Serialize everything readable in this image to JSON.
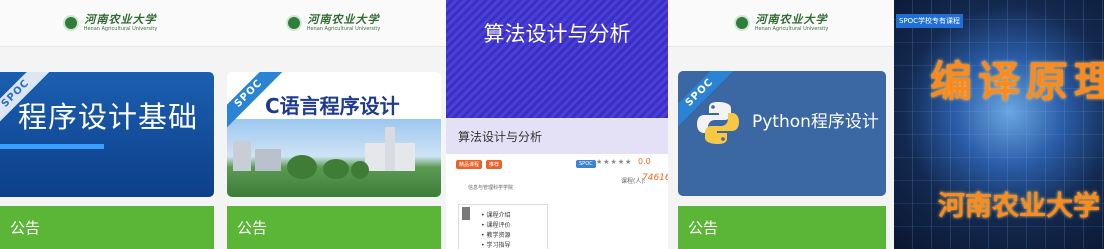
{
  "panels": [
    {
      "logo_cn": "河南农业大学",
      "logo_en": "Henan Agricultural University",
      "badge": "SPOC",
      "course_title": "程序设计基础",
      "notice": "公告"
    },
    {
      "logo_cn": "河南农业大学",
      "logo_en": "Henan Agricultural University",
      "badge": "SPOC",
      "course_title": "C语言程序设计",
      "notice": "公告"
    },
    {
      "banner_title": "算法设计与分析",
      "course_title": "算法设计与分析",
      "tags": [
        "精品课程",
        "推荐"
      ],
      "spoc_tag": "SPOC",
      "rating": "0.0",
      "learners_label": "课程(人):",
      "learners": "74616",
      "school": "信息与管理科学学院",
      "menu": [
        "课程介绍",
        "课程评价",
        "教学资源",
        "学习指导"
      ]
    },
    {
      "logo_cn": "河南农业大学",
      "logo_en": "Henan Agricultural University",
      "badge": "SPOC",
      "course_title": "Python程序设计",
      "notice": "公告"
    },
    {
      "tag": "SPOC学校专有课程",
      "course_title": "编译原理",
      "school": "河南农业大学"
    }
  ],
  "colors": {
    "notice_green": "#5bb536",
    "logo_green": "#2f7d3b",
    "accent_orange": "#ff8a1c"
  },
  "icons": [
    "university-seal-icon",
    "python-logo-icon",
    "book-icon"
  ]
}
